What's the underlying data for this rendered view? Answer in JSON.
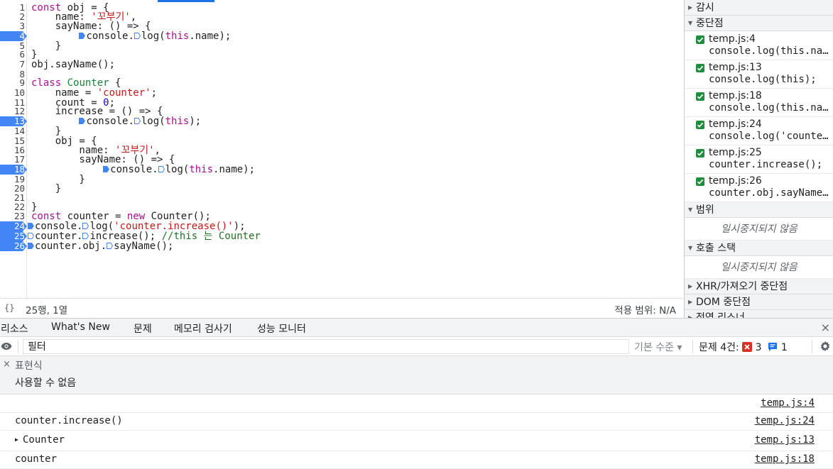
{
  "editor": {
    "lines": [
      {
        "n": "1",
        "bp": false
      },
      {
        "n": "2",
        "bp": false
      },
      {
        "n": "3",
        "bp": false
      },
      {
        "n": "4",
        "bp": true
      },
      {
        "n": "5",
        "bp": false
      },
      {
        "n": "6",
        "bp": false
      },
      {
        "n": "7",
        "bp": false
      },
      {
        "n": "8",
        "bp": false
      },
      {
        "n": "9",
        "bp": false
      },
      {
        "n": "10",
        "bp": false
      },
      {
        "n": "11",
        "bp": false
      },
      {
        "n": "12",
        "bp": false
      },
      {
        "n": "13",
        "bp": true
      },
      {
        "n": "14",
        "bp": false
      },
      {
        "n": "15",
        "bp": false
      },
      {
        "n": "16",
        "bp": false
      },
      {
        "n": "17",
        "bp": false
      },
      {
        "n": "18",
        "bp": true
      },
      {
        "n": "19",
        "bp": false
      },
      {
        "n": "20",
        "bp": false
      },
      {
        "n": "21",
        "bp": false
      },
      {
        "n": "22",
        "bp": false
      },
      {
        "n": "23",
        "bp": false
      },
      {
        "n": "24",
        "bp": true
      },
      {
        "n": "25",
        "bp": true
      },
      {
        "n": "26",
        "bp": true
      }
    ],
    "code": {
      "l1": {
        "kw": "const",
        "rest": " obj = {"
      },
      "l2": {
        "pre": "    name: ",
        "str": "'꼬부기'",
        "post": ","
      },
      "l3": "    sayName: () => {",
      "l4": {
        "pre": "        ",
        "a": "console.",
        "b": "log(",
        "kw": "this",
        "c": ".name);"
      },
      "l5": "    }",
      "l6": "}",
      "l7": "obj.sayName();",
      "l8": "",
      "l9": {
        "kw": "class",
        "sp": " ",
        "cls": "Counter",
        "rest": " {"
      },
      "l10": {
        "pre": "    name = ",
        "str": "'counter'",
        "post": ";"
      },
      "l11": {
        "pre": "    count = ",
        "num": "0",
        "post": ";"
      },
      "l12": "    increase = () => {",
      "l13": {
        "pre": "        ",
        "a": "console.",
        "b": "log(",
        "kw": "this",
        "c": ");"
      },
      "l14": "    }",
      "l15": "    obj = {",
      "l16": {
        "pre": "        name: ",
        "str": "'꼬부기'",
        "post": ","
      },
      "l17": "        sayName: () => {",
      "l18": {
        "pre": "            ",
        "a": "console.",
        "b": "log(",
        "kw": "this",
        "c": ".name);"
      },
      "l19": "        }",
      "l20": "    }",
      "l21": "",
      "l22": "}",
      "l23": {
        "kw": "const",
        "mid": " counter = ",
        "kw2": "new",
        "rest": " Counter();"
      },
      "l24": {
        "a": "console.",
        "b": "log(",
        "str": "'counter.increase()'",
        "c": ");"
      },
      "l25": {
        "a": "counter.",
        "b": "increase(); ",
        "cm": "//this 는 Counter"
      },
      "l26": {
        "a": "counter.obj.",
        "b": "sayName();"
      }
    },
    "status": {
      "format_icon": "{}",
      "cursor": "25행, 1열",
      "coverage": "적용 범위: N/A"
    }
  },
  "sidebar": {
    "watch": "감시",
    "breakpoints": {
      "title": "중단점",
      "items": [
        {
          "file": "temp.js:4",
          "code": "console.log(this.name);"
        },
        {
          "file": "temp.js:13",
          "code": "console.log(this);"
        },
        {
          "file": "temp.js:18",
          "code": "console.log(this.name);"
        },
        {
          "file": "temp.js:24",
          "code": "console.log('counter.increase()');"
        },
        {
          "file": "temp.js:25",
          "code": "counter.increase();"
        },
        {
          "file": "temp.js:26",
          "code": "counter.obj.sayName();"
        }
      ]
    },
    "scope": {
      "title": "범위",
      "empty": "일시중지되지 않음"
    },
    "callstack": {
      "title": "호출 스택",
      "empty": "일시중지되지 않음"
    },
    "xhr": "XHR/가져오기 중단점",
    "dom": "DOM 중단점",
    "listeners": "전역 리스너"
  },
  "drawer": {
    "tabs": [
      "리소스",
      "What's New",
      "문제",
      "메모리 검사기",
      "성능 모니터"
    ],
    "close": "×"
  },
  "toolbar": {
    "filter_placeholder": "필터",
    "levels": "기본 수준 ▾",
    "issues_label": "문제 4건:",
    "errors": "3",
    "info": "1"
  },
  "expressions": {
    "label": "표현식",
    "value": "사용할 수 없음",
    "close": "×"
  },
  "console": {
    "messages": [
      {
        "text": "",
        "source": "temp.js:4",
        "expandable": false
      },
      {
        "text": "counter.increase()",
        "source": "temp.js:24",
        "expandable": false
      },
      {
        "text": "Counter",
        "source": "temp.js:13",
        "expandable": true
      },
      {
        "text": "counter",
        "source": "temp.js:18",
        "expandable": false
      }
    ]
  },
  "icons": {
    "eye": "eye-icon",
    "settings": "gear-icon",
    "error": "error-icon",
    "info": "info-message-icon"
  },
  "colors": {
    "breakpoint": "#4285f4",
    "accent": "#1a73e8",
    "check": "#1e8e3e",
    "error": "#d93025"
  }
}
